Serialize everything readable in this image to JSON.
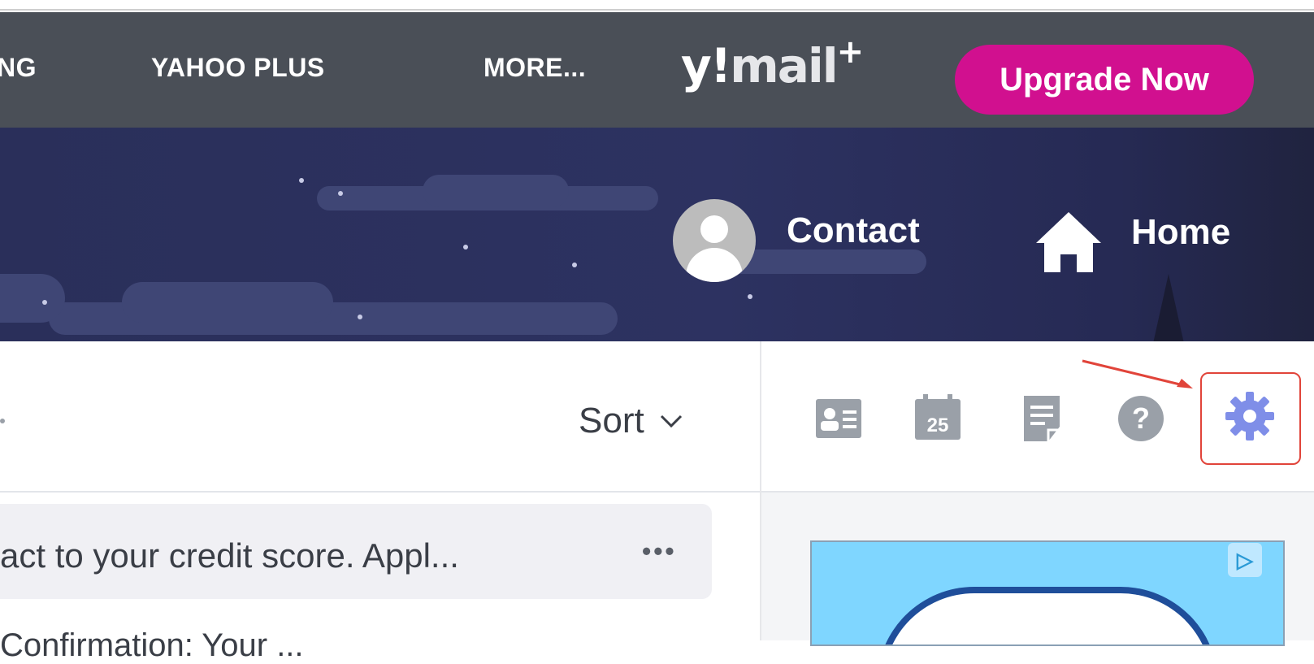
{
  "top_nav": {
    "links": [
      "NG",
      "YAHOO PLUS",
      "MORE..."
    ],
    "brand": {
      "y": "y",
      "bang": "!",
      "mail": "mail",
      "plus": "+"
    },
    "upgrade_label": "Upgrade Now",
    "colors": {
      "bar": "#4a4f57",
      "upgrade": "#d1108f"
    }
  },
  "banner": {
    "contact_label": "Contact",
    "home_label": "Home"
  },
  "toolbar": {
    "sort_label": "Sort",
    "icons": [
      "contact-card-icon",
      "calendar-icon",
      "notepad-icon",
      "help-icon",
      "settings-icon"
    ],
    "calendar_day": "25",
    "help_glyph": "?"
  },
  "message_list": {
    "preview_text": "act to your credit score. Appl...",
    "more_glyph": "•••",
    "next_row_text": "Confirmation: Your ..."
  },
  "ad": {
    "choices_glyph": "▷"
  }
}
